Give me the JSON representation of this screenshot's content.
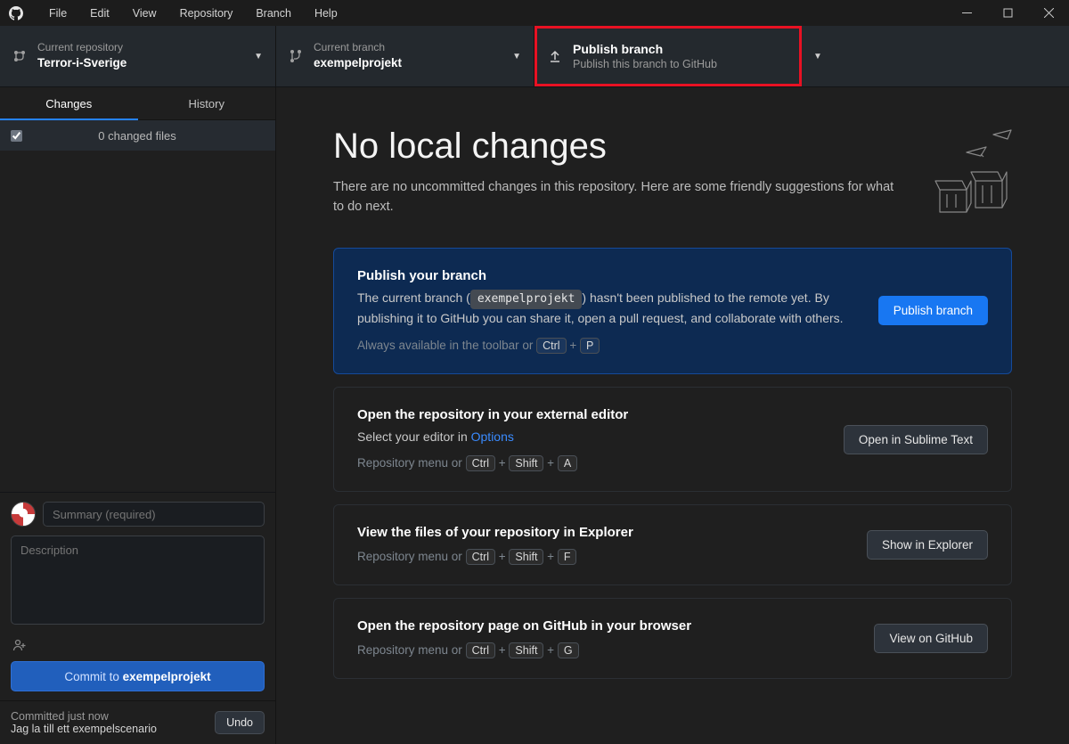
{
  "menubar": {
    "items": [
      "File",
      "Edit",
      "View",
      "Repository",
      "Branch",
      "Help"
    ]
  },
  "toolbar": {
    "repo": {
      "label": "Current repository",
      "value": "Terror-i-Sverige"
    },
    "branch": {
      "label": "Current branch",
      "value": "exempelprojekt"
    },
    "publish": {
      "title": "Publish branch",
      "subtitle": "Publish this branch to GitHub"
    }
  },
  "sidebar": {
    "tabs": {
      "changes": "Changes",
      "history": "History"
    },
    "changed_files": "0 changed files",
    "summary_placeholder": "Summary (required)",
    "description_placeholder": "Description",
    "commit_prefix": "Commit to ",
    "commit_branch": "exempelprojekt"
  },
  "undo": {
    "time": "Committed just now",
    "message": "Jag la till ett exempelscenario",
    "button": "Undo"
  },
  "content": {
    "heading": "No local changes",
    "subtitle": "There are no uncommitted changes in this repository. Here are some friendly suggestions for what to do next."
  },
  "cards": {
    "publish": {
      "title": "Publish your branch",
      "line1a": "The current branch (",
      "branch": "exempelprojekt",
      "line1b": ") hasn't been published to the remote yet. By publishing it to GitHub you can share it, open a pull request, and collaborate with others.",
      "hint_prefix": "Always available in the toolbar or ",
      "kbd1": "Ctrl",
      "kbd2": "P",
      "button": "Publish branch"
    },
    "editor": {
      "title": "Open the repository in your external editor",
      "line": "Select your editor in ",
      "link": "Options",
      "hint_prefix": "Repository menu or ",
      "kbd1": "Ctrl",
      "kbd2": "Shift",
      "kbd3": "A",
      "button": "Open in Sublime Text"
    },
    "explorer": {
      "title": "View the files of your repository in Explorer",
      "hint_prefix": "Repository menu or ",
      "kbd1": "Ctrl",
      "kbd2": "Shift",
      "kbd3": "F",
      "button": "Show in Explorer"
    },
    "github": {
      "title": "Open the repository page on GitHub in your browser",
      "hint_prefix": "Repository menu or ",
      "kbd1": "Ctrl",
      "kbd2": "Shift",
      "kbd3": "G",
      "button": "View on GitHub"
    }
  }
}
